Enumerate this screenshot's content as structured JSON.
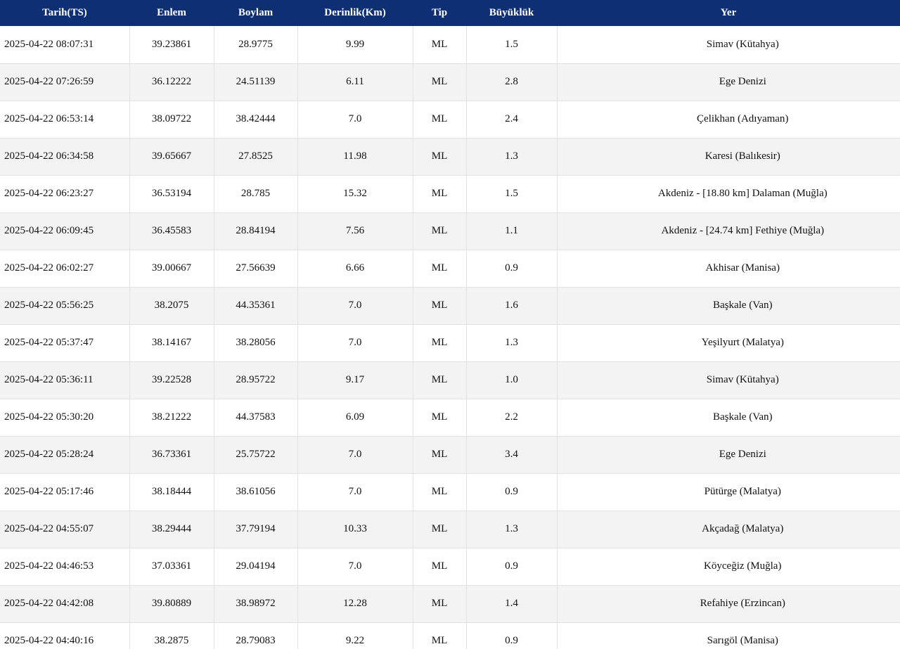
{
  "table": {
    "headers": [
      "Tarih(TS)",
      "Enlem",
      "Boylam",
      "Derinlik(Km)",
      "Tip",
      "Büyüklük",
      "Yer"
    ],
    "rows": [
      [
        "2025-04-22 08:07:31",
        "39.23861",
        "28.9775",
        "9.99",
        "ML",
        "1.5",
        "Simav (Kütahya)"
      ],
      [
        "2025-04-22 07:26:59",
        "36.12222",
        "24.51139",
        "6.11",
        "ML",
        "2.8",
        "Ege Denizi"
      ],
      [
        "2025-04-22 06:53:14",
        "38.09722",
        "38.42444",
        "7.0",
        "ML",
        "2.4",
        "Çelikhan (Adıyaman)"
      ],
      [
        "2025-04-22 06:34:58",
        "39.65667",
        "27.8525",
        "11.98",
        "ML",
        "1.3",
        "Karesi (Balıkesir)"
      ],
      [
        "2025-04-22 06:23:27",
        "36.53194",
        "28.785",
        "15.32",
        "ML",
        "1.5",
        "Akdeniz - [18.80 km] Dalaman (Muğla)"
      ],
      [
        "2025-04-22 06:09:45",
        "36.45583",
        "28.84194",
        "7.56",
        "ML",
        "1.1",
        "Akdeniz - [24.74 km] Fethiye (Muğla)"
      ],
      [
        "2025-04-22 06:02:27",
        "39.00667",
        "27.56639",
        "6.66",
        "ML",
        "0.9",
        "Akhisar (Manisa)"
      ],
      [
        "2025-04-22 05:56:25",
        "38.2075",
        "44.35361",
        "7.0",
        "ML",
        "1.6",
        "Başkale (Van)"
      ],
      [
        "2025-04-22 05:37:47",
        "38.14167",
        "38.28056",
        "7.0",
        "ML",
        "1.3",
        "Yeşilyurt (Malatya)"
      ],
      [
        "2025-04-22 05:36:11",
        "39.22528",
        "28.95722",
        "9.17",
        "ML",
        "1.0",
        "Simav (Kütahya)"
      ],
      [
        "2025-04-22 05:30:20",
        "38.21222",
        "44.37583",
        "6.09",
        "ML",
        "2.2",
        "Başkale (Van)"
      ],
      [
        "2025-04-22 05:28:24",
        "36.73361",
        "25.75722",
        "7.0",
        "ML",
        "3.4",
        "Ege Denizi"
      ],
      [
        "2025-04-22 05:17:46",
        "38.18444",
        "38.61056",
        "7.0",
        "ML",
        "0.9",
        "Pütürge (Malatya)"
      ],
      [
        "2025-04-22 04:55:07",
        "38.29444",
        "37.79194",
        "10.33",
        "ML",
        "1.3",
        "Akçadağ (Malatya)"
      ],
      [
        "2025-04-22 04:46:53",
        "37.03361",
        "29.04194",
        "7.0",
        "ML",
        "0.9",
        "Köyceğiz (Muğla)"
      ],
      [
        "2025-04-22 04:42:08",
        "39.80889",
        "38.98972",
        "12.28",
        "ML",
        "1.4",
        "Refahiye (Erzincan)"
      ],
      [
        "2025-04-22 04:40:16",
        "38.2875",
        "28.79083",
        "9.22",
        "ML",
        "0.9",
        "Sarıgöl (Manisa)"
      ]
    ]
  },
  "colors": {
    "header_bg": "#0f2f74",
    "header_text": "#ffffff",
    "row_alt_bg": "#f3f3f3",
    "border": "#e2e2e2"
  }
}
